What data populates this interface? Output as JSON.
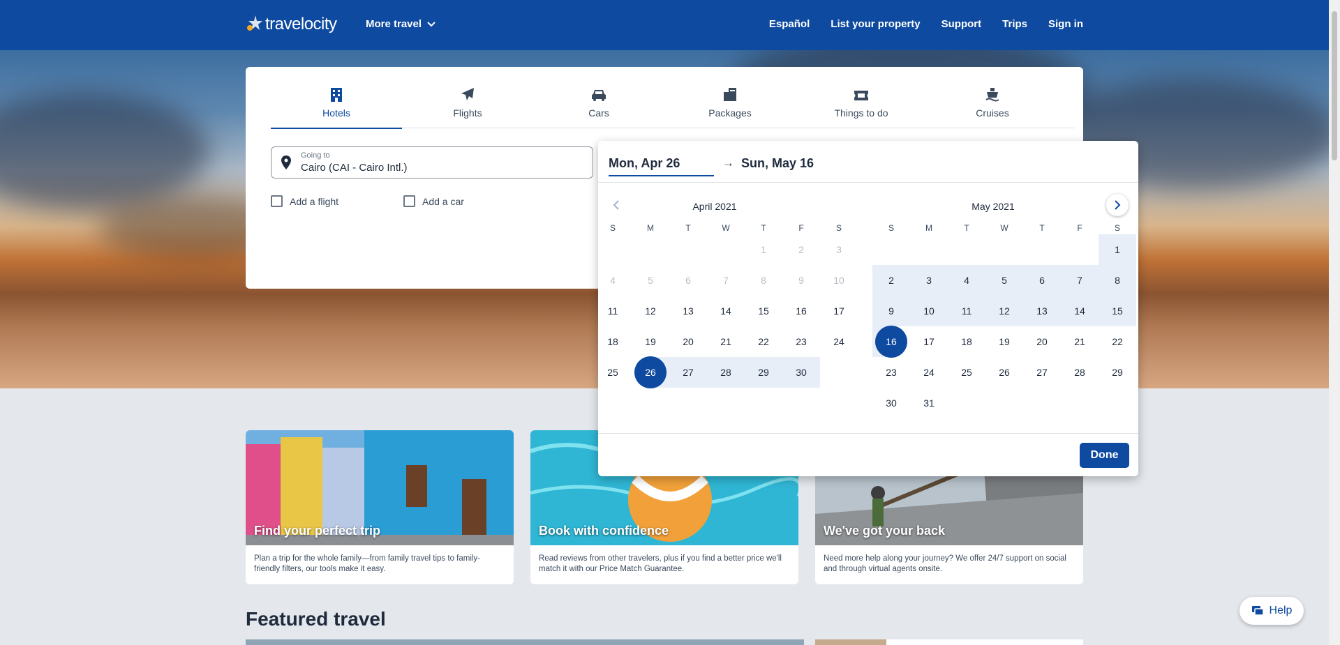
{
  "header": {
    "logo": "travelocity",
    "more_travel": "More travel",
    "nav": [
      "Español",
      "List your property",
      "Support",
      "Trips",
      "Sign in"
    ]
  },
  "search": {
    "tabs": [
      "Hotels",
      "Flights",
      "Cars",
      "Packages",
      "Things to do",
      "Cruises"
    ],
    "active_tab": "Hotels",
    "going_label": "Going to",
    "going_value": "Cairo (CAI - Cairo Intl.)",
    "add_flight": "Add a flight",
    "add_car": "Add a car"
  },
  "calendar": {
    "start_date": "Mon, Apr 26",
    "end_date": "Sun, May 16",
    "weekdays": [
      "S",
      "M",
      "T",
      "W",
      "T",
      "F",
      "S"
    ],
    "months": [
      {
        "title": "April 2021",
        "first_weekday": 4,
        "days": 30,
        "muted_until": 11
      },
      {
        "title": "May 2021",
        "first_weekday": 6,
        "days": 31,
        "muted_until": 0
      }
    ],
    "selected_start": {
      "month": 0,
      "day": 26
    },
    "selected_end": {
      "month": 1,
      "day": 16
    },
    "done_label": "Done"
  },
  "cards": [
    {
      "title": "Find your perfect trip",
      "text": "Plan a trip for the whole family—from family travel tips to family-friendly filters, our tools make it easy."
    },
    {
      "title": "Book with confidence",
      "text": "Read reviews from other travelers, plus if you find a better price we'll match it with our Price Match Guarantee."
    },
    {
      "title": "We've got your back",
      "text": "Need more help along your journey? We offer 24/7 support on social and through virtual agents onsite."
    }
  ],
  "featured_title": "Featured travel",
  "help_label": "Help",
  "colors": {
    "brand": "#0d4aa0",
    "range": "#e8eef8"
  }
}
